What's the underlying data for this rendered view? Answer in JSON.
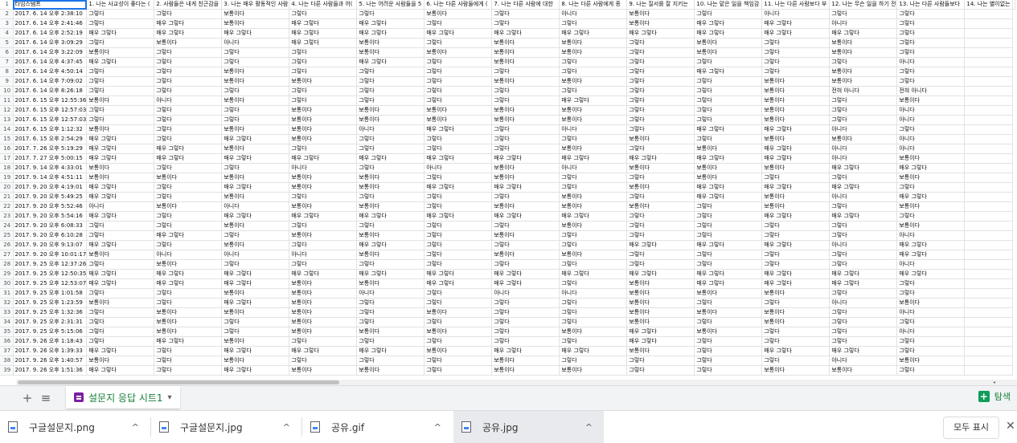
{
  "sheet": {
    "header_row_number": "1",
    "header_cells": [
      "타임스탬프",
      "1. 나는 사교성이 좋다는 (",
      "2. 사람들은 내게 친근감을",
      "3. 나는 매우 활동적인 사람",
      "4. 나는 다른 사람들과 어(",
      "5. 나는 어려운 사람들을 5",
      "6. 나는 다른 사람들에게 (",
      "7. 나는 다른 사람에 대한",
      "8. 나는 다른 사람에게 종",
      "9. 나는 질서를 잘 지키는",
      "10. 나는 맡은 일을 책임감",
      "11. 나는 다른 사람보다 부",
      "12. 나는 무슨 일을 하기 전",
      "13. 나는 다른 사람들보다",
      "14. 나는 별이없는"
    ],
    "rows": [
      [
        "2",
        "2017. 6. 14 오후 2:38:10",
        "그렇다",
        "그렇다",
        "보통이다",
        "그렇다",
        "그렇다",
        "보통이다",
        "그렇다",
        "아니다",
        "보통이다",
        "그렇다",
        "아니다",
        "그렇다",
        "그렇다"
      ],
      [
        "3",
        "2017. 6. 14 오후 2:41:46",
        "그렇다",
        "매우 그렇다",
        "보통이다",
        "매우 그렇다",
        "매우 그렇다",
        "그렇다",
        "그렇다",
        "그렇다",
        "보통이다",
        "매우 그렇다",
        "매우 그렇다",
        "아니다",
        "그렇다"
      ],
      [
        "4",
        "2017. 6. 14 오후 2:52:19",
        "매우 그렇다",
        "매우 그렇다",
        "매우 그렇다",
        "매우 그렇다",
        "매우 그렇다",
        "매우 그렇다",
        "매우 그렇다",
        "매우 그렇다",
        "매우 그렇다",
        "매우 그렇다",
        "매우 그렇다",
        "매우 그렇다",
        "그렇다"
      ],
      [
        "5",
        "2017. 6. 14 오후 3:09:29",
        "그렇다",
        "보통이다",
        "아니다",
        "매우 그렇다",
        "보통이다",
        "그렇다",
        "보통이다",
        "보통이다",
        "그렇다",
        "보통이다",
        "그렇다",
        "보통이다",
        "그렇다"
      ],
      [
        "6",
        "2017. 6. 14 오후 3:22:09",
        "보통이다",
        "그렇다",
        "그렇다",
        "그렇다",
        "보통이다",
        "보통이다",
        "보통이다",
        "보통이다",
        "그렇다",
        "보통이다",
        "그렇다",
        "보통이다",
        "그렇다"
      ],
      [
        "7",
        "2017. 6. 14 오후 4:37:45",
        "매우 그렇다",
        "그렇다",
        "그렇다",
        "그렇다",
        "매우 그렇다",
        "그렇다",
        "보통이다",
        "그렇다",
        "그렇다",
        "그렇다",
        "그렇다",
        "그렇다",
        "아니다"
      ],
      [
        "8",
        "2017. 6. 14 오후 4:50:14",
        "그렇다",
        "그렇다",
        "보통이다",
        "그렇다",
        "그렇다",
        "그렇다",
        "그렇다",
        "그렇다",
        "그렇다",
        "매우 그렇다",
        "그렇다",
        "보통이다",
        "그렇다"
      ],
      [
        "9",
        "2017. 6. 14 오후 7:09:02",
        "그렇다",
        "그렇다",
        "보통이다",
        "보통이다",
        "그렇다",
        "그렇다",
        "보통이다",
        "보통이다",
        "그렇다",
        "그렇다",
        "보통이다",
        "보통이다",
        "그렇다"
      ],
      [
        "10",
        "2017. 6. 14 오후 8:26:18",
        "그렇다",
        "그렇다",
        "그렇다",
        "그렇다",
        "그렇다",
        "그렇다",
        "그렇다",
        "그렇다",
        "그렇다",
        "그렇다",
        "보통이다",
        "전혀 아니다",
        "전혀 아니다"
      ],
      [
        "11",
        "2017. 6. 15 오후 12:55:36",
        "보통이다",
        "아니다",
        "보통이다",
        "그렇다",
        "그렇다",
        "그렇다",
        "그렇다",
        "매우 그렇다",
        "그렇다",
        "그렇다",
        "보통이다",
        "그렇다",
        "보통이다"
      ],
      [
        "12",
        "2017. 6. 15 오후 12:57:03",
        "그렇다",
        "그렇다",
        "그렇다",
        "보통이다",
        "보통이다",
        "보통이다",
        "보통이다",
        "보통이다",
        "그렇다",
        "그렇다",
        "보통이다",
        "그렇다",
        "아니다"
      ],
      [
        "13",
        "2017. 6. 15 오후 12:57:03",
        "그렇다",
        "그렇다",
        "그렇다",
        "보통이다",
        "보통이다",
        "보통이다",
        "보통이다",
        "보통이다",
        "그렇다",
        "그렇다",
        "보통이다",
        "그렇다",
        "아니다"
      ],
      [
        "14",
        "2017. 6. 15 오후 1:12:32",
        "보통이다",
        "그렇다",
        "보통이다",
        "보통이다",
        "아니다",
        "매우 그렇다",
        "그렇다",
        "아니다",
        "그렇다",
        "매우 그렇다",
        "매우 그렇다",
        "아니다",
        "그렇다"
      ],
      [
        "15",
        "2017. 6. 15 오후 2:54:29",
        "매우 그렇다",
        "그렇다",
        "매우 그렇다",
        "보통이다",
        "그렇다",
        "그렇다",
        "그렇다",
        "그렇다",
        "보통이다",
        "그렇다",
        "보통이다",
        "보통이다",
        "아니다"
      ],
      [
        "16",
        "2017. 7. 26 오후 5:19:29",
        "매우 그렇다",
        "매우 그렇다",
        "보통이다",
        "그렇다",
        "그렇다",
        "그렇다",
        "그렇다",
        "보통이다",
        "그렇다",
        "보통이다",
        "매우 그렇다",
        "아니다",
        "아니다"
      ],
      [
        "17",
        "2017. 7. 27 오후 5:00:15",
        "매우 그렇다",
        "매우 그렇다",
        "매우 그렇다",
        "매우 그렇다",
        "매우 그렇다",
        "매우 그렇다",
        "매우 그렇다",
        "매우 그렇다",
        "매우 그렇다",
        "매우 그렇다",
        "매우 그렇다",
        "아니다",
        "보통이다"
      ],
      [
        "18",
        "2017. 9. 14 오후 4:33:01",
        "보통이다",
        "그렇다",
        "그렇다",
        "아니다",
        "그렇다",
        "아니다",
        "보통이다",
        "아니다",
        "보통이다",
        "보통이다",
        "보통이다",
        "매우 그렇다",
        "매우 그렇다"
      ],
      [
        "19",
        "2017. 9. 14 오후 4:51:11",
        "보통이다",
        "보통이다",
        "보통이다",
        "보통이다",
        "보통이다",
        "그렇다",
        "보통이다",
        "그렇다",
        "그렇다",
        "보통이다",
        "그렇다",
        "그렇다",
        "보통이다"
      ],
      [
        "20",
        "2017. 9. 20 오후 4:19:01",
        "매우 그렇다",
        "그렇다",
        "매우 그렇다",
        "보통이다",
        "보통이다",
        "매우 그렇다",
        "매우 그렇다",
        "그렇다",
        "보통이다",
        "매우 그렇다",
        "매우 그렇다",
        "매우 그렇다",
        "그렇다"
      ],
      [
        "21",
        "2017. 9. 20 오후 5:49:25",
        "매우 그렇다",
        "그렇다",
        "보통이다",
        "그렇다",
        "그렇다",
        "그렇다",
        "그렇다",
        "보통이다",
        "그렇다",
        "매우 그렇다",
        "보통이다",
        "아니다",
        "매우 그렇다"
      ],
      [
        "22",
        "2017. 9. 20 오후 5:52:46",
        "아니다",
        "보통이다",
        "아니다",
        "보통이다",
        "보통이다",
        "그렇다",
        "보통이다",
        "보통이다",
        "보통이다",
        "그렇다",
        "보통이다",
        "그렇다",
        "보통이다"
      ],
      [
        "23",
        "2017. 9. 20 오후 5:54:16",
        "매우 그렇다",
        "그렇다",
        "매우 그렇다",
        "매우 그렇다",
        "매우 그렇다",
        "매우 그렇다",
        "매우 그렇다",
        "매우 그렇다",
        "그렇다",
        "그렇다",
        "매우 그렇다",
        "매우 그렇다",
        "그렇다"
      ],
      [
        "24",
        "2017. 9. 20 오후 6:08:33",
        "그렇다",
        "그렇다",
        "보통이다",
        "그렇다",
        "그렇다",
        "그렇다",
        "그렇다",
        "보통이다",
        "그렇다",
        "그렇다",
        "그렇다",
        "그렇다",
        "보통이다"
      ],
      [
        "25",
        "2017. 9. 20 오후 6:10:28",
        "그렇다",
        "매우 그렇다",
        "그렇다",
        "보통이다",
        "보통이다",
        "그렇다",
        "보통이다",
        "그렇다",
        "그렇다",
        "그렇다",
        "그렇다",
        "그렇다",
        "아니다"
      ],
      [
        "26",
        "2017. 9. 20 오후 9:13:07",
        "매우 그렇다",
        "그렇다",
        "보통이다",
        "그렇다",
        "매우 그렇다",
        "그렇다",
        "그렇다",
        "그렇다",
        "매우 그렇다",
        "매우 그렇다",
        "매우 그렇다",
        "아니다",
        "매우 그렇다"
      ],
      [
        "27",
        "2017. 9. 20 오후 10:01:17",
        "보통이다",
        "아니다",
        "아니다",
        "아니다",
        "보통이다",
        "그렇다",
        "보통이다",
        "보통이다",
        "그렇다",
        "그렇다",
        "그렇다",
        "그렇다",
        "매우 그렇다"
      ],
      [
        "28",
        "2017. 9. 25 오후 12:37:26",
        "그렇다",
        "보통이다",
        "그렇다",
        "그렇다",
        "그렇다",
        "그렇다",
        "그렇다",
        "그렇다",
        "그렇다",
        "그렇다",
        "그렇다",
        "그렇다",
        "아니다"
      ],
      [
        "29",
        "2017. 9. 25 오후 12:50:35",
        "매우 그렇다",
        "매우 그렇다",
        "매우 그렇다",
        "매우 그렇다",
        "매우 그렇다",
        "매우 그렇다",
        "매우 그렇다",
        "매우 그렇다",
        "매우 그렇다",
        "매우 그렇다",
        "매우 그렇다",
        "매우 그렇다",
        "매우 그렇다"
      ],
      [
        "30",
        "2017. 9. 25 오후 12:53:07",
        "매우 그렇다",
        "매우 그렇다",
        "매우 그렇다",
        "보통이다",
        "보통이다",
        "매우 그렇다",
        "매우 그렇다",
        "그렇다",
        "보통이다",
        "매우 그렇다",
        "매우 그렇다",
        "매우 그렇다",
        "그렇다"
      ],
      [
        "31",
        "2017. 9. 25 오후 1:01:58",
        "그렇다",
        "그렇다",
        "보통이다",
        "보통이다",
        "아니다",
        "그렇다",
        "아니다",
        "아니다",
        "보통이다",
        "보통이다",
        "보통이다",
        "그렇다",
        "그렇다"
      ],
      [
        "32",
        "2017. 9. 25 오후 1:23:59",
        "보통이다",
        "그렇다",
        "매우 그렇다",
        "보통이다",
        "그렇다",
        "그렇다",
        "그렇다",
        "그렇다",
        "보통이다",
        "그렇다",
        "그렇다",
        "아니다",
        "보통이다"
      ],
      [
        "33",
        "2017. 9. 25 오후 1:32:36",
        "그렇다",
        "보통이다",
        "보통이다",
        "보통이다",
        "그렇다",
        "보통이다",
        "그렇다",
        "그렇다",
        "보통이다",
        "보통이다",
        "보통이다",
        "그렇다",
        "아니다"
      ],
      [
        "34",
        "2017. 9. 25 오후 2:31:31",
        "그렇다",
        "보통이다",
        "그렇다",
        "보통이다",
        "그렇다",
        "그렇다",
        "그렇다",
        "그렇다",
        "보통이다",
        "그렇다",
        "보통이다",
        "그렇다",
        "그렇다"
      ],
      [
        "35",
        "2017. 9. 25 오후 5:15:06",
        "그렇다",
        "보통이다",
        "그렇다",
        "보통이다",
        "보통이다",
        "보통이다",
        "그렇다",
        "보통이다",
        "매우 그렇다",
        "보통이다",
        "그렇다",
        "그렇다",
        "아니다"
      ],
      [
        "36",
        "2017. 9. 26 오후 1:18:43",
        "그렇다",
        "매우 그렇다",
        "보통이다",
        "그렇다",
        "그렇다",
        "그렇다",
        "그렇다",
        "그렇다",
        "매우 그렇다",
        "그렇다",
        "그렇다",
        "그렇다",
        "그렇다"
      ],
      [
        "37",
        "2017. 9. 26 오후 1:39:33",
        "매우 그렇다",
        "그렇다",
        "매우 그렇다",
        "매우 그렇다",
        "매우 그렇다",
        "보통이다",
        "매우 그렇다",
        "매우 그렇다",
        "보통이다",
        "그렇다",
        "매우 그렇다",
        "매우 그렇다",
        "그렇다"
      ],
      [
        "38",
        "2017. 9. 26 오후 1:40:57",
        "보통이다",
        "그렇다",
        "보통이다",
        "그렇다",
        "그렇다",
        "그렇다",
        "보통이다",
        "그렇다",
        "그렇다",
        "그렇다",
        "그렇다",
        "아니다",
        "보통이다"
      ],
      [
        "39",
        "2017. 9. 26 오후 1:51:36",
        "매우 그렇다",
        "그렇다",
        "매우 그렇다",
        "보통이다",
        "보통이다",
        "그렇다",
        "보통이다",
        "보통이다",
        "그렇다",
        "그렇다",
        "보통이다",
        "보통이다",
        "그렇다"
      ]
    ]
  },
  "tabbar": {
    "add_label": "+",
    "list_label": "≡",
    "sheet_name": "설문지 응답 시트1",
    "sheet_caret": "▾",
    "explore_label": "탐색",
    "explore_glyph": "+"
  },
  "scrollbar": {
    "left_arrow": "◂",
    "right_arrow": "▸"
  },
  "downloads": {
    "items": [
      {
        "name": "구글설문지.png",
        "chevron": "^"
      },
      {
        "name": "구글설문지.jpg",
        "chevron": "^"
      },
      {
        "name": "공유.gif",
        "chevron": "^"
      },
      {
        "name": "공유.jpg",
        "chevron": "^"
      }
    ],
    "show_all": "모두 표시",
    "close": "✕"
  },
  "colors": {
    "accent": "#1a73e8",
    "sheet_green": "#188038",
    "forms_purple": "#7b1fa2"
  }
}
